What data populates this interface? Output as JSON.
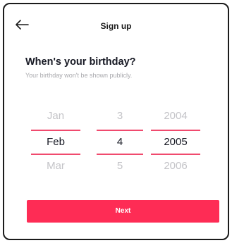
{
  "header": {
    "title": "Sign up",
    "back_icon": "arrow-left-icon"
  },
  "main": {
    "heading": "When's your birthday?",
    "subtitle": "Your birthday won't be shown publicly."
  },
  "picker": {
    "month": {
      "prev": "Jan",
      "selected": "Feb",
      "next": "Mar"
    },
    "day": {
      "prev": "3",
      "selected": "4",
      "next": "5"
    },
    "year": {
      "prev": "2004",
      "selected": "2005",
      "next": "2006"
    }
  },
  "actions": {
    "next_label": "Next"
  },
  "colors": {
    "accent": "#fe2c55",
    "divider": "#f04a6e",
    "text": "#161823",
    "muted": "#c4c4c8"
  }
}
